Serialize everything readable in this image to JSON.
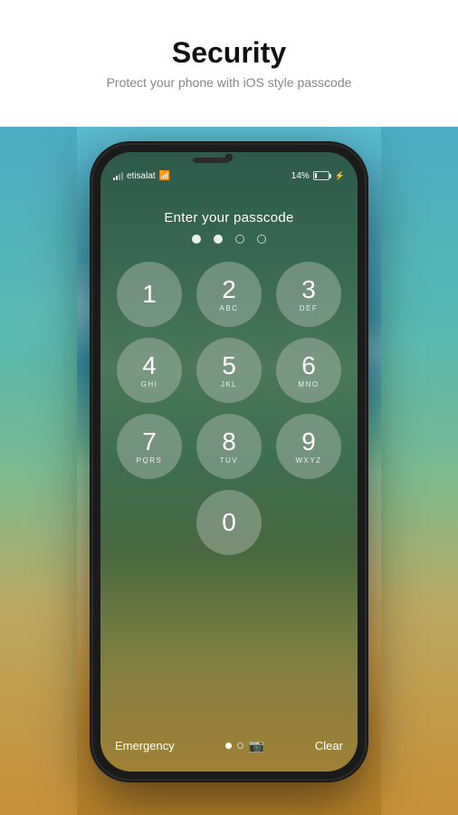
{
  "header": {
    "title": "Security",
    "subtitle": "Protect your phone with iOS style passcode"
  },
  "status_bar": {
    "carrier": "etisalat",
    "battery_percent": "14%",
    "time": ""
  },
  "passcode_screen": {
    "prompt": "Enter your passcode",
    "dots": [
      {
        "filled": true
      },
      {
        "filled": true
      },
      {
        "filled": false
      },
      {
        "filled": false
      }
    ],
    "keys": [
      {
        "number": "1",
        "letters": ""
      },
      {
        "number": "2",
        "letters": "ABC"
      },
      {
        "number": "3",
        "letters": "DEF"
      },
      {
        "number": "4",
        "letters": "GHI"
      },
      {
        "number": "5",
        "letters": "JKL"
      },
      {
        "number": "6",
        "letters": "MNO"
      },
      {
        "number": "7",
        "letters": "PQRS"
      },
      {
        "number": "8",
        "letters": "TUV"
      },
      {
        "number": "9",
        "letters": "WXYZ"
      },
      {
        "number": "0",
        "letters": ""
      }
    ],
    "bottom": {
      "emergency": "Emergency",
      "clear": "Clear"
    }
  }
}
